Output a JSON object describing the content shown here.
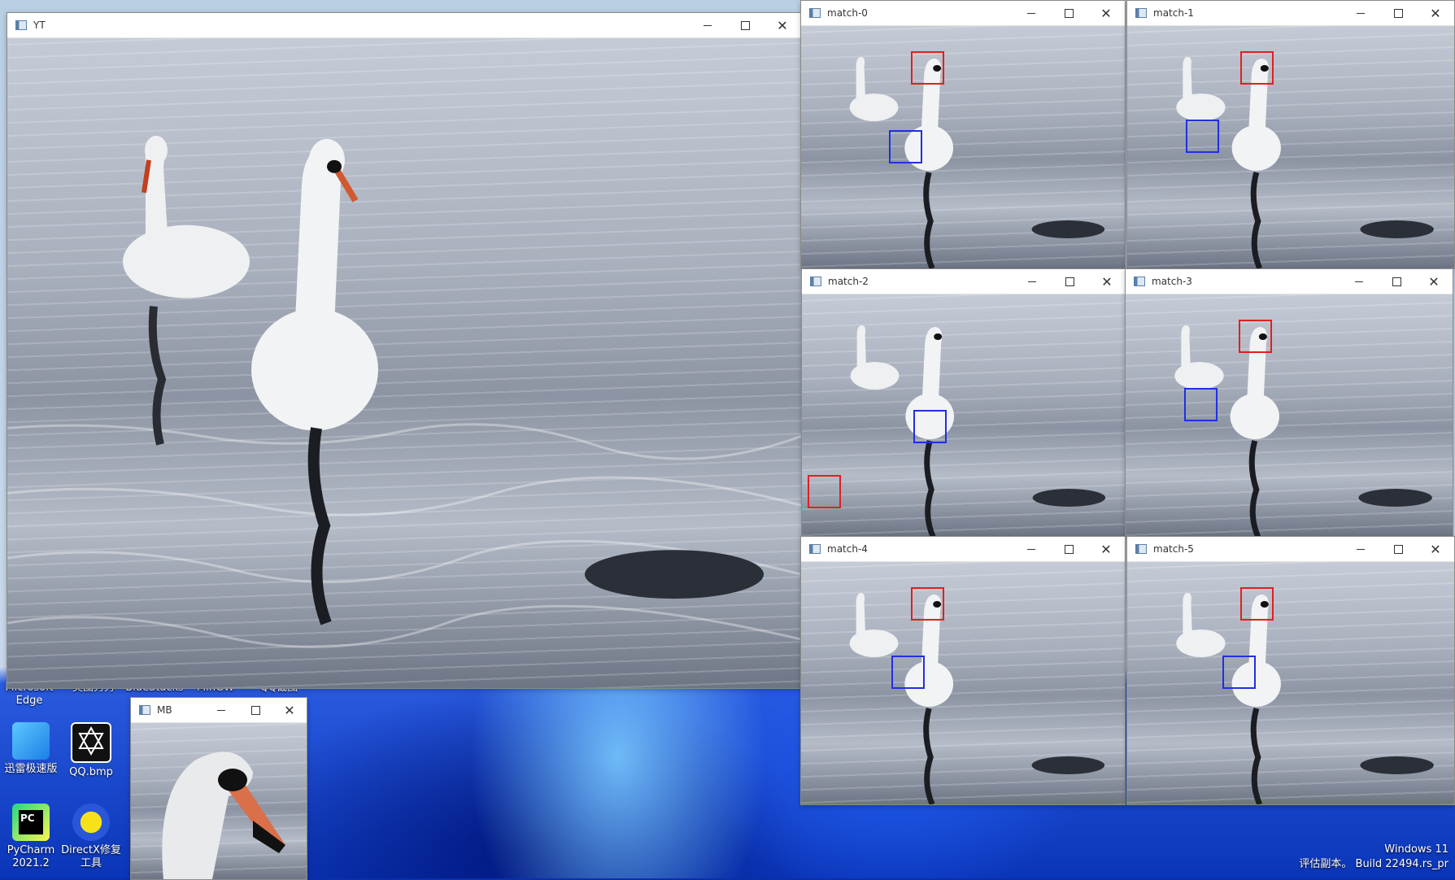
{
  "desktop": {
    "icons": [
      {
        "label": "Microsoft Edge",
        "name": "edge"
      },
      {
        "label": "美图秀秀",
        "name": "meitu"
      },
      {
        "label": "BlueStacks",
        "name": "bluestacks"
      },
      {
        "label": "MinGW",
        "name": "mingw"
      },
      {
        "label": "QQ截图",
        "name": "qq-screenshot"
      },
      {
        "label": "迅雷极速版",
        "name": "xunlei"
      },
      {
        "label": "QQ.bmp",
        "name": "qq-bmp"
      },
      {
        "label": "PyCharm 2021.2",
        "name": "pycharm"
      },
      {
        "label": "DirectX修复工具",
        "name": "directx-repair"
      }
    ],
    "watermark_line1": "Windows 11",
    "watermark_line2": "评估副本。 Build 22494.rs_pr"
  },
  "windows": {
    "yt": {
      "title": "YT"
    },
    "mb": {
      "title": "MB"
    },
    "matches": [
      {
        "title": "match-0"
      },
      {
        "title": "match-1"
      },
      {
        "title": "match-2"
      },
      {
        "title": "match-3"
      },
      {
        "title": "match-4"
      },
      {
        "title": "match-5"
      }
    ]
  },
  "colors": {
    "red_box": "#e02020",
    "blue_box": "#2030e0",
    "titlebar": "#ffffff"
  },
  "icons": {
    "minimize": "minimize-icon",
    "maximize": "maximize-icon",
    "close": "close-icon"
  }
}
